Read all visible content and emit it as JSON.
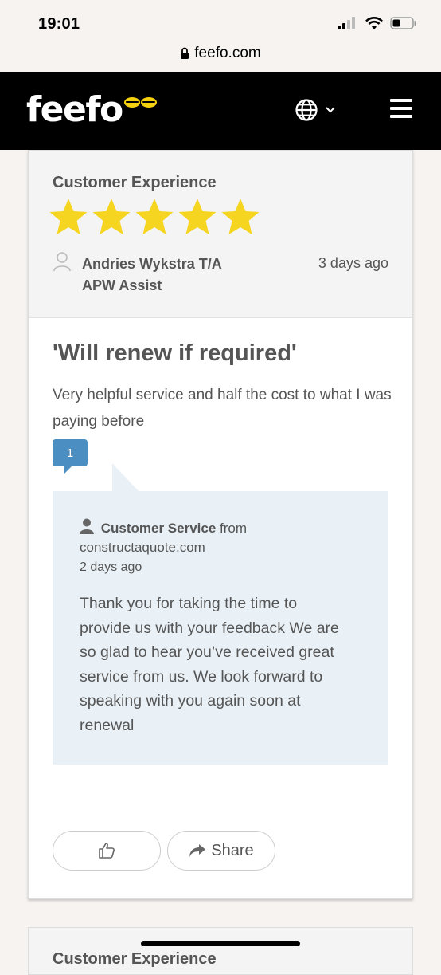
{
  "status_bar": {
    "time": "19:01"
  },
  "browser": {
    "url": "feefo.com"
  },
  "header": {
    "logo_text": "feefo"
  },
  "review": {
    "section_title": "Customer Experience",
    "rating": 5,
    "max_rating": 5,
    "reviewer": "Andries Wykstra T/A APW Assist",
    "date": "3 days ago",
    "title": "'Will renew if required'",
    "body": "Very helpful service and half the cost to what I was paying before",
    "reply_count": "1"
  },
  "reply": {
    "author": "Customer Service",
    "from_label": "from",
    "company": "constructaquote.com",
    "date": "2 days ago",
    "text": "Thank you for taking the time to provide us with your feedback We are so glad to hear you’ve received great service from us. We look forward to speaking with you again soon at renewal"
  },
  "actions": {
    "share_label": "Share"
  },
  "next_card": {
    "section_title": "Customer Experience"
  },
  "colors": {
    "star": "#f5d51f",
    "header_bg": "#000000",
    "reply_bg": "#e9f1f7",
    "badge": "#4b8fc2"
  }
}
